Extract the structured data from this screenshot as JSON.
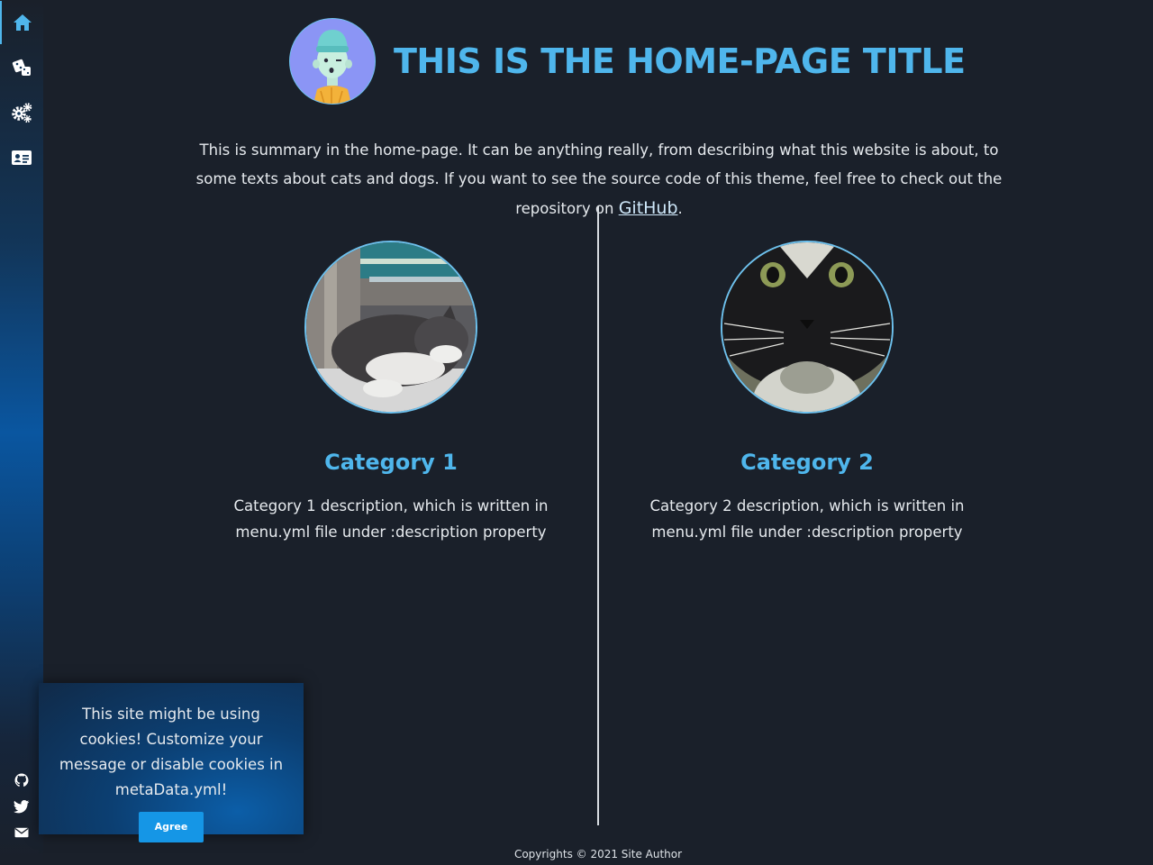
{
  "sidebar": {
    "items": [
      {
        "icon": "home-icon",
        "active": true
      },
      {
        "icon": "dice-icon",
        "active": false
      },
      {
        "icon": "gears-icon",
        "active": false
      },
      {
        "icon": "id-card-icon",
        "active": false
      }
    ],
    "social": [
      {
        "icon": "github-icon"
      },
      {
        "icon": "twitter-icon"
      },
      {
        "icon": "envelope-icon"
      }
    ]
  },
  "header": {
    "title": "THIS IS THE HOME-PAGE TITLE"
  },
  "summary": {
    "text": "This is summary in the home-page. It can be anything really, from describing what this website is about, to some texts about cats and dogs. If you want to see the source code of this theme, feel free to check out the repository on ",
    "link_text": "GitHub",
    "end": "."
  },
  "categories": [
    {
      "title": "Category 1",
      "description": "Category 1 description, which is written in menu.yml file under :description property"
    },
    {
      "title": "Category 2",
      "description": "Category 2 description, which is written in menu.yml file under :description property"
    }
  ],
  "cookie": {
    "message": "This site might be using cookies! Customize your message or disable cookies in metaData.yml!",
    "button": "Agree"
  },
  "footer": {
    "text": "Copyrights © 2021 Site Author"
  },
  "colors": {
    "background": "#1a202a",
    "accent": "#4fb6ec",
    "sidebar_mid": "#0a56a0",
    "button": "#1596e6"
  }
}
